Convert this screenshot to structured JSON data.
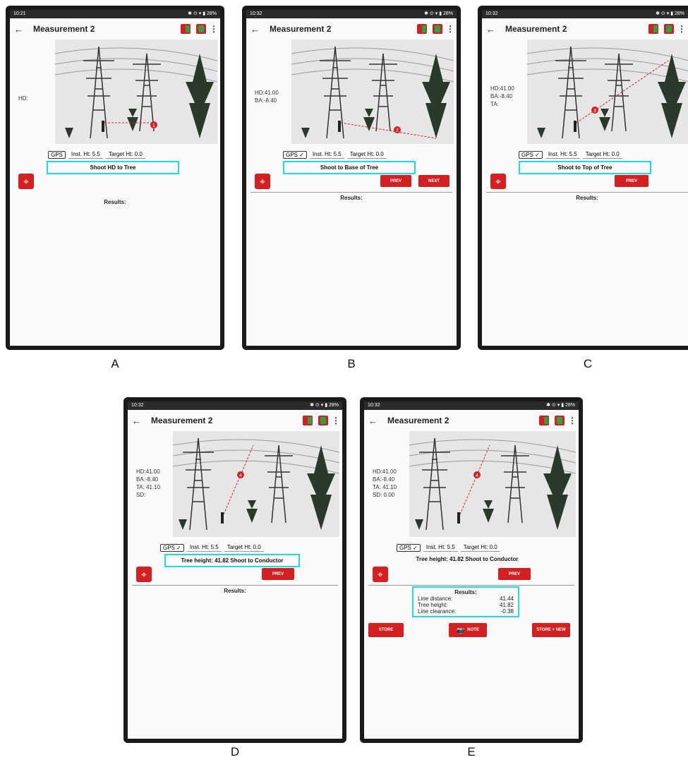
{
  "screens": {
    "A": {
      "status_time": "10:21",
      "status_right": "✱ ⊙ ▾ ▮ 28%",
      "title": "Measurement 2",
      "readings": [
        "HD:"
      ],
      "gps": "GPS",
      "inst_ht": "Inst. Ht: 5.5",
      "target_ht": "Target Ht: 0.0",
      "prompt": "Shoot HD to Tree",
      "results": "Results:",
      "marker": "1"
    },
    "B": {
      "status_time": "10:32",
      "status_right": "✱ ⊙ ▾ ▮ 28%",
      "title": "Measurement 2",
      "readings": [
        "HD:41.00",
        "BA:-8.40"
      ],
      "gps": "GPS ✓",
      "inst_ht": "Inst. Ht: 5.5",
      "target_ht": "Target Ht: 0.0",
      "prompt": "Shoot to Base of Tree",
      "prev": "PREV",
      "next": "NEXT",
      "results": "Results:",
      "marker": "2"
    },
    "C": {
      "status_time": "10:32",
      "status_right": "✱ ⊙ ▾ ▮ 28%",
      "title": "Measurement 2",
      "readings": [
        "HD:41.00",
        "BA:-8.40",
        "TA:"
      ],
      "gps": "GPS ✓",
      "inst_ht": "Inst. Ht: 5.5",
      "target_ht": "Target Ht: 0.0",
      "prompt": "Shoot to Top of Tree",
      "prev": "PREV",
      "results": "Results:",
      "marker": "3"
    },
    "D": {
      "status_time": "10:32",
      "status_right": "✱ ⊙ ▾ ▮ 28%",
      "title": "Measurement 2",
      "readings": [
        "HD:41.00",
        "BA:-8.40",
        "TA: 41.10",
        "SD:"
      ],
      "gps": "GPS ✓",
      "inst_ht": "Inst. Ht: 5.5",
      "target_ht": "Target Ht: 0.0",
      "prompt": "Tree height: 41.82   Shoot to Conductor",
      "prev": "PREV",
      "results": "Results:",
      "marker": "4"
    },
    "E": {
      "status_time": "10:32",
      "status_right": "✱ ⊙ ▾ ▮ 28%",
      "title": "Measurement 2",
      "readings": [
        "HD:41.00",
        "BA:-8.40",
        "TA: 41.10",
        "SD: 0.00"
      ],
      "gps": "GPS ✓",
      "inst_ht": "Inst. Ht: 5.5",
      "target_ht": "Target Ht: 0.0",
      "prompt": "Tree height: 41.82   Shoot to Conductor",
      "prev": "PREV",
      "results": "Results:",
      "result_rows": [
        {
          "label": "Line distance:",
          "value": "41.44"
        },
        {
          "label": "Tree height:",
          "value": "41.82"
        },
        {
          "label": "Line clearance:",
          "value": "-0.38"
        }
      ],
      "store": "STORE",
      "note": "NOTE",
      "store_new": "STORE + NEW",
      "marker": "4"
    }
  },
  "panel_labels": [
    "A",
    "B",
    "C",
    "D",
    "E"
  ],
  "colors": {
    "accent_red": "#d42020",
    "highlight": "#20d8e8"
  }
}
